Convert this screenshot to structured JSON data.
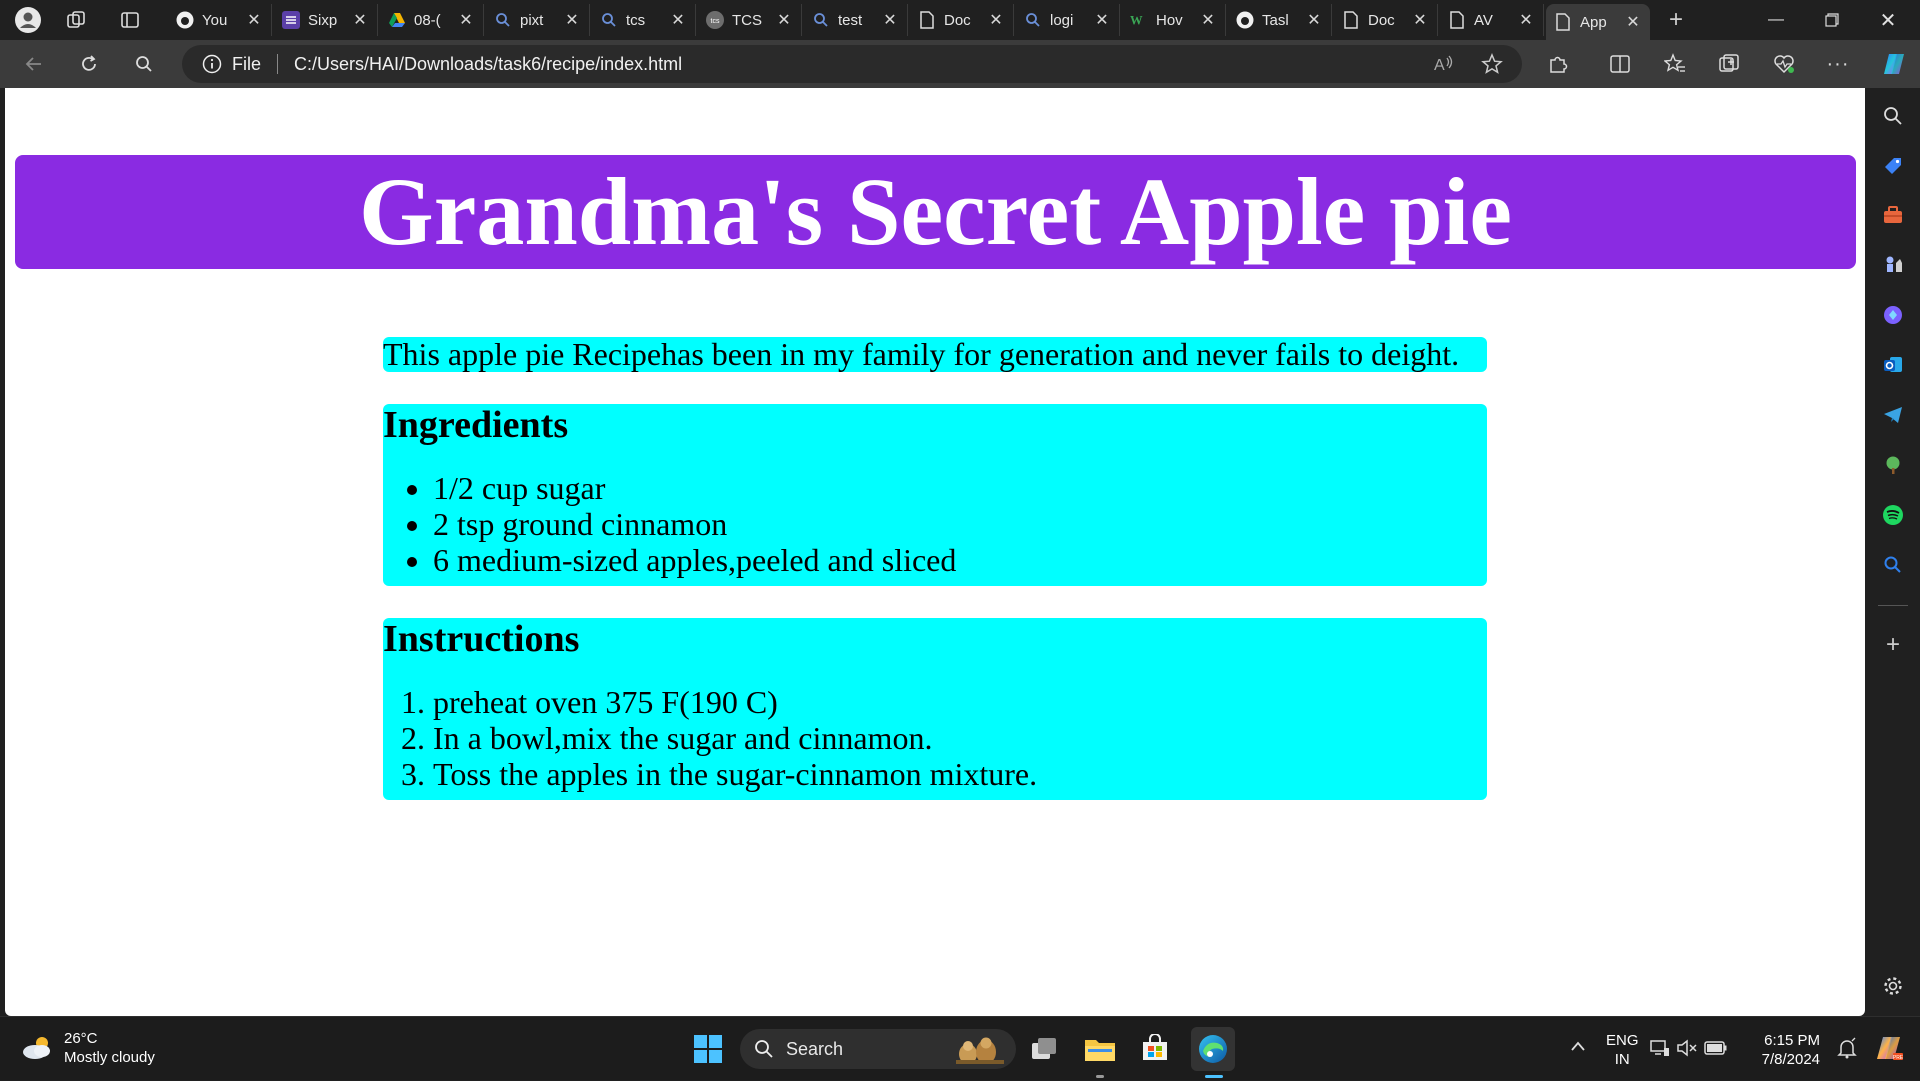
{
  "browser": {
    "tabs": [
      {
        "title": "You",
        "icon": "github-icon"
      },
      {
        "title": "Sixp",
        "icon": "list-icon"
      },
      {
        "title": "08-(",
        "icon": "drive-icon"
      },
      {
        "title": "pixt",
        "icon": "search-icon"
      },
      {
        "title": "tcs",
        "icon": "search-icon"
      },
      {
        "title": "TCS",
        "icon": "tcs-icon"
      },
      {
        "title": "test",
        "icon": "search-icon"
      },
      {
        "title": "Doc",
        "icon": "page-icon"
      },
      {
        "title": "logi",
        "icon": "search-icon"
      },
      {
        "title": "Hov",
        "icon": "w-icon"
      },
      {
        "title": "Tasl",
        "icon": "github-icon"
      },
      {
        "title": "Doc",
        "icon": "page-icon"
      },
      {
        "title": "AV",
        "icon": "page-icon"
      },
      {
        "title": "App",
        "icon": "page-icon",
        "active": true
      }
    ],
    "address": {
      "scheme_label": "File",
      "url": "C:/Users/HAI/Downloads/task6/recipe/index.html"
    }
  },
  "page": {
    "title": "Grandma's Secret Apple pie",
    "intro": "This apple pie Recipehas been in my family for generation and never fails to deight.",
    "ingredients": {
      "heading": "Ingredients",
      "items": [
        "1/2 cup sugar",
        "2 tsp ground cinnamon",
        "6 medium-sized apples,peeled and sliced"
      ]
    },
    "instructions": {
      "heading": "Instructions",
      "steps": [
        "preheat oven 375 F(190 C)",
        "In a bowl,mix the sugar and cinnamon.",
        "Toss the apples in the sugar-cinnamon mixture."
      ]
    },
    "colors": {
      "header": "#8a2be2",
      "box": "#00ffff"
    }
  },
  "taskbar": {
    "weather": {
      "temp": "26°C",
      "condition": "Mostly cloudy"
    },
    "search_label": "Search",
    "lang": {
      "line1": "ENG",
      "line2": "IN"
    },
    "clock": {
      "time": "6:15 PM",
      "date": "7/8/2024"
    }
  }
}
